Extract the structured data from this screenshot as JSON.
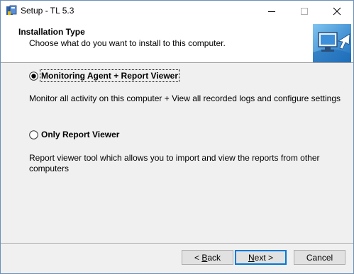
{
  "window": {
    "title": "Setup - TL 5.3"
  },
  "header": {
    "title": "Installation Type",
    "subtitle": "Choose what do you want to install to this computer."
  },
  "options": [
    {
      "label": "Monitoring Agent + Report Viewer",
      "selected": true,
      "description": "Monitor all activity on this computer + View all recorded logs and configure settings"
    },
    {
      "label": "Only Report Viewer",
      "selected": false,
      "description": "Report viewer tool which allows you to import and view the reports from other computers"
    }
  ],
  "buttons": {
    "back_prefix": "< ",
    "back_mnemonic": "B",
    "back_rest": "ack",
    "next_mnemonic": "N",
    "next_rest": "ext >",
    "cancel": "Cancel"
  },
  "colors": {
    "accent": "#0078d7",
    "header_bg": "#ffffff",
    "window_bg": "#f0f0f0"
  }
}
